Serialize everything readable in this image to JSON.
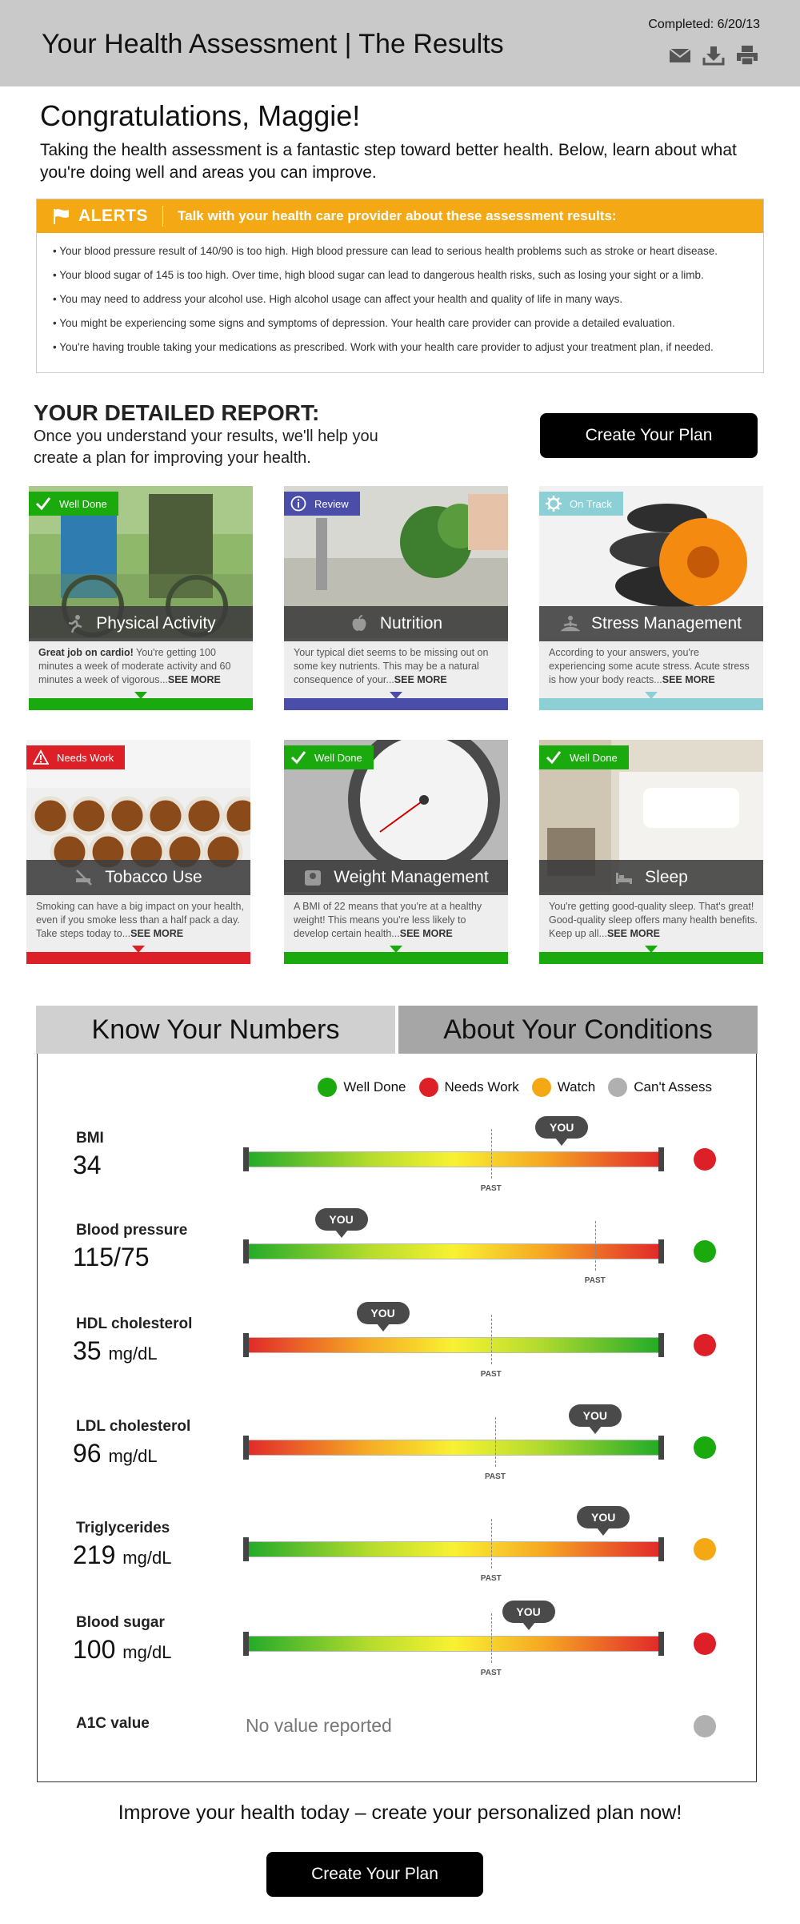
{
  "header": {
    "title": "Your Health Assessment | The Results",
    "completed": "Completed: 6/20/13",
    "icons": [
      "mail-icon",
      "download-icon",
      "print-icon"
    ]
  },
  "intro": {
    "greeting": "Congratulations, Maggie!",
    "text": "Taking the health assessment is a fantastic step toward better health. Below, learn about what you're doing well and areas you can improve."
  },
  "alerts": {
    "title": "ALERTS",
    "message": "Talk with your health care provider about these assessment results:",
    "items": [
      "• Your blood pressure result of 140/90 is too high. High blood pressure can lead to serious health problems such as stroke or heart disease.",
      "• Your blood sugar of 145 is too high. Over time, high blood sugar can lead to dangerous health risks, such as losing your sight or a limb.",
      "• You may need to address your alcohol use. High alcohol usage can affect your health and quality of life in many ways.",
      "• You might be experiencing some signs and symptoms of depression. Your health care provider can provide a detailed evaluation.",
      "• You're having trouble taking your medications as prescribed. Work with your health care provider to adjust your treatment plan, if needed."
    ]
  },
  "report": {
    "title": "YOUR DETAILED REPORT:",
    "subtitle": "Once you understand your results, we'll help you create a plan for improving your health.",
    "create_plan": "Create Your Plan"
  },
  "colors": {
    "well_done": "#1aaa0e",
    "needs_work": "#dd2027",
    "watch": "#f4a814",
    "cant_assess": "#b0b0b0",
    "review": "#4a4ea8",
    "on_track": "#8ccfd4"
  },
  "cards": [
    {
      "badge": "Well Done",
      "title": "Physical Activity",
      "lead": "Great job on cardio!",
      "text": " You're getting 100 minutes a week of moderate activity and 60 minutes a week of vigorous...",
      "more": "SEE MORE",
      "icon": "running-icon"
    },
    {
      "badge": "Review",
      "title": "Nutrition",
      "lead": "",
      "text": "Your typical diet seems to be missing out on some key nutrients. This may be a natural consequence of your...",
      "more": "SEE MORE",
      "icon": "apple-icon"
    },
    {
      "badge": "On Track",
      "title": "Stress Management",
      "lead": "",
      "text": "According to your answers, you're experiencing some acute stress. Acute stress is how your body reacts...",
      "more": "SEE MORE",
      "icon": "meditation-icon"
    },
    {
      "badge": "Needs Work",
      "title": "Tobacco Use",
      "lead": "",
      "text": "Smoking can have a big impact on your health, even if you smoke less than a half pack a day. Take steps today to...",
      "more": "SEE MORE",
      "icon": "no-smoking-icon"
    },
    {
      "badge": "Well Done",
      "title": "Weight Management",
      "lead": "",
      "text": "A BMI of 22 means that you're at a healthy weight! This means you're less likely to develop certain health...",
      "more": "SEE MORE",
      "icon": "scale-icon"
    },
    {
      "badge": "Well Done",
      "title": "Sleep",
      "lead": "",
      "text": "You're getting good-quality sleep. That's great! Good-quality sleep offers many health benefits. Keep up all...",
      "more": "SEE MORE",
      "icon": "bed-icon"
    }
  ],
  "tabs": {
    "know_numbers": "Know Your Numbers",
    "about_conditions": "About Your Conditions"
  },
  "legend": {
    "well_done": "Well Done",
    "needs_work": "Needs Work",
    "watch": "Watch",
    "cant_assess": "Can't Assess"
  },
  "markers": {
    "you": "YOU",
    "past": "PAST"
  },
  "metrics": [
    {
      "name": "BMI",
      "value": "34",
      "unit": "",
      "status": "needs_work",
      "gradient": "green-red",
      "you": 0.76,
      "past": 0.59
    },
    {
      "name": "Blood pressure",
      "value": "115/75",
      "unit": "",
      "status": "well_done",
      "gradient": "green-red",
      "you": 0.23,
      "past": 0.84
    },
    {
      "name": "HDL cholesterol",
      "value": "35",
      "unit": "mg/dL",
      "status": "needs_work",
      "gradient": "red-green",
      "you": 0.33,
      "past": 0.59
    },
    {
      "name": "LDL cholesterol",
      "value": "96",
      "unit": "mg/dL",
      "status": "well_done",
      "gradient": "red-green",
      "you": 0.84,
      "past": 0.6
    },
    {
      "name": "Triglycerides",
      "value": "219",
      "unit": "mg/dL",
      "status": "watch",
      "gradient": "green-red",
      "you": 0.86,
      "past": 0.59
    },
    {
      "name": "Blood sugar",
      "value": "100",
      "unit": "mg/dL",
      "status": "needs_work",
      "gradient": "green-red",
      "you": 0.68,
      "past": 0.59
    }
  ],
  "a1c": {
    "name": "A1C value",
    "message": "No value reported",
    "status": "cant_assess"
  },
  "cta": {
    "text": "Improve your health today – create your personalized plan now!",
    "button": "Create Your Plan"
  }
}
